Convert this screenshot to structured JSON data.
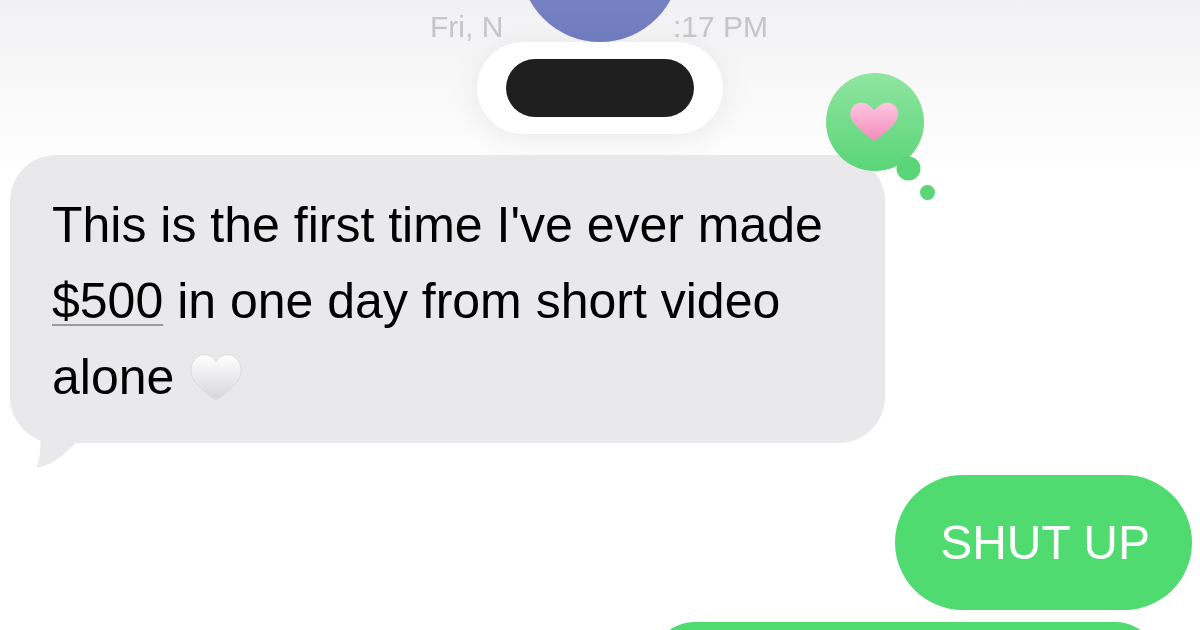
{
  "header": {
    "timestamp_left": "Fri, N",
    "timestamp_right": ":17 PM"
  },
  "messages": [
    {
      "kind": "received",
      "reacted": true,
      "parts": [
        {
          "kind": "text",
          "text": "This is the first time I've ever made"
        },
        {
          "kind": "link",
          "text": "$500"
        },
        {
          "kind": "text",
          "text": "in one day from short video alone"
        },
        {
          "kind": "emoji"
        }
      ]
    },
    {
      "kind": "sent",
      "reacted": false,
      "parts": [
        {
          "kind": "text",
          "text": "SHUT UP"
        }
      ]
    },
    {
      "kind": "cutoff",
      "reacted": false
    }
  ]
}
